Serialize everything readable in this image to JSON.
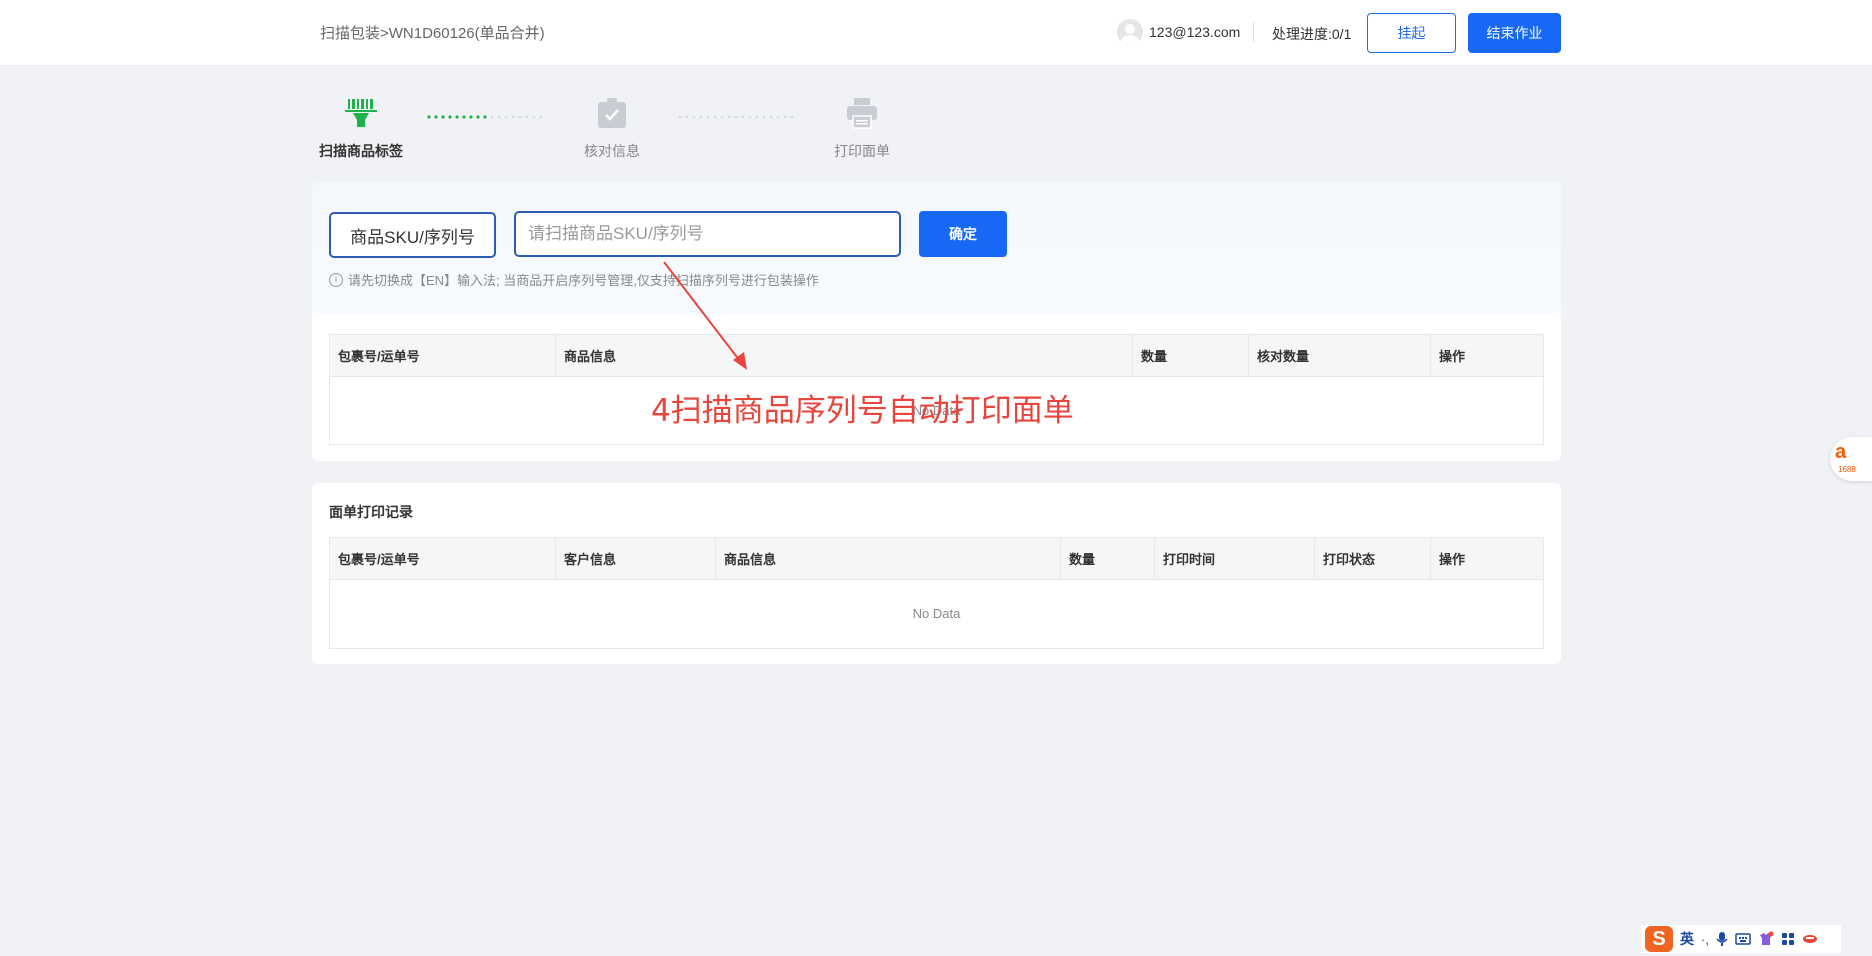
{
  "header": {
    "breadcrumb": "扫描包装>WN1D60126(单品合并)",
    "user": "123@123.com",
    "progress": "处理进度:0/1",
    "hang_button": "挂起",
    "end_button": "结束作业"
  },
  "steps": [
    {
      "label": "扫描商品标签",
      "icon": "barcode-scanner-icon",
      "active": true
    },
    {
      "label": "核对信息",
      "icon": "check-box-icon",
      "active": false
    },
    {
      "label": "打印面单",
      "icon": "printer-icon",
      "active": false
    }
  ],
  "scan": {
    "type_select": "商品SKU/序列号",
    "input_placeholder": "请扫描商品SKU/序列号",
    "confirm_button": "确定",
    "hint": "请先切换成【EN】输入法; 当商品开启序列号管理,仅支持扫描序列号进行包装操作"
  },
  "scan_table": {
    "columns": [
      "包裹号/运单号",
      "商品信息",
      "数量",
      "核对数量",
      "操作"
    ],
    "empty_text": "No Data"
  },
  "record": {
    "title": "面单打印记录",
    "columns": [
      "包裹号/运单号",
      "客户信息",
      "商品信息",
      "数量",
      "打印时间",
      "打印状态",
      "操作"
    ],
    "empty_text": "No Data"
  },
  "annotation": {
    "text": "4扫描商品序列号自动打印面单",
    "color": "#e8453c"
  },
  "widget": {
    "logo": "a",
    "number": "1688"
  },
  "ime": {
    "lang": "英",
    "items": [
      "·,",
      "mic-icon",
      "keyboard-icon",
      "skin-icon",
      "grid-icon",
      "tools-icon"
    ]
  },
  "colors": {
    "primary": "#1668f5",
    "step_active": "#1fb14a",
    "step_inactive": "#c9ccd2"
  }
}
